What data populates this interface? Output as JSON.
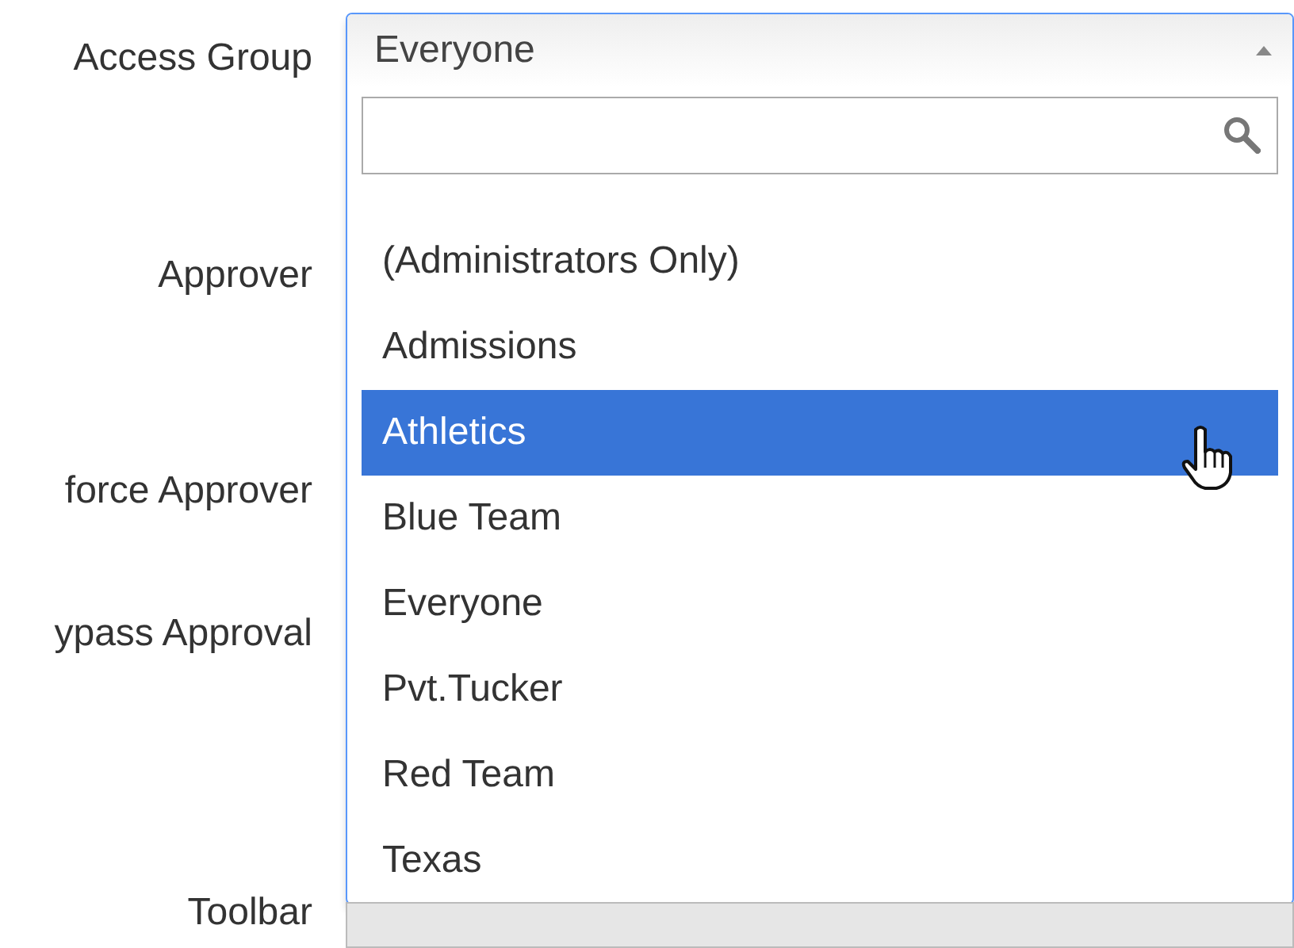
{
  "form_labels": [
    "Access Group",
    "Approver",
    "force Approver",
    "ypass Approval",
    "Toolbar"
  ],
  "select": {
    "value": "Everyone",
    "expanded": true,
    "options": [
      {
        "label": "(Administrators Only)",
        "highlighted": false
      },
      {
        "label": "Admissions",
        "highlighted": false
      },
      {
        "label": "Athletics",
        "highlighted": true
      },
      {
        "label": "Blue Team",
        "highlighted": false
      },
      {
        "label": "Everyone",
        "highlighted": false
      },
      {
        "label": "Pvt.Tucker",
        "highlighted": false
      },
      {
        "label": "Red Team",
        "highlighted": false
      },
      {
        "label": "Texas",
        "highlighted": false
      }
    ]
  }
}
